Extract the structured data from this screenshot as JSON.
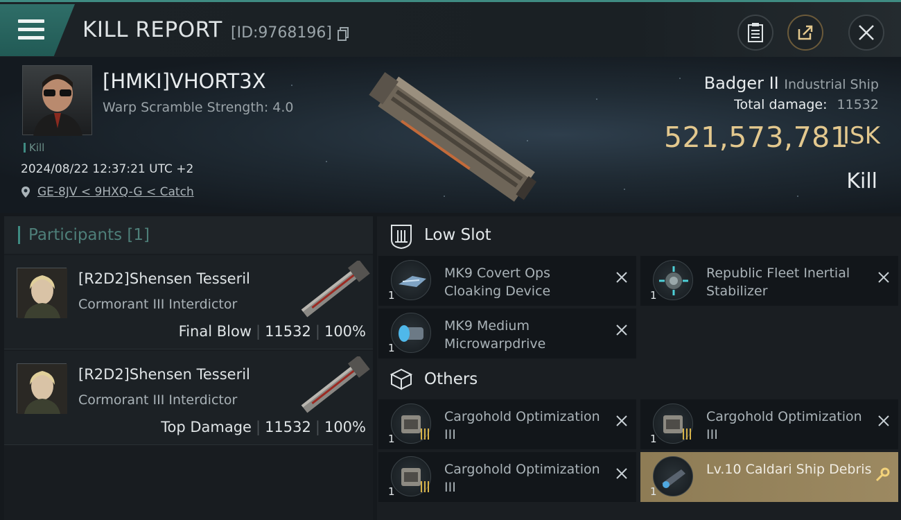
{
  "header": {
    "title": "KILL REPORT",
    "report_id": "[ID:9768196]"
  },
  "victim": {
    "pilot_name": "[HMKI]VHORT3X",
    "warp_scramble": "Warp Scramble Strength: 4.0",
    "tag": "Kill",
    "datetime": "2024/08/22 12:37:21 UTC +2",
    "location": "GE-8JV < 9HXQ-G < Catch",
    "ship_name": "Badger II",
    "ship_class": "Industrial Ship",
    "total_damage_label": "Total damage:",
    "total_damage": "11532",
    "isk_value": "521,573,781",
    "isk_unit": "ISK",
    "result": "Kill"
  },
  "participants": {
    "title": "Participants [1]",
    "cards": [
      {
        "name": "[R2D2]Shensen Tesseril",
        "ship": "Cormorant III Interdictor",
        "role": "Final Blow",
        "damage": "11532",
        "percent": "100%"
      },
      {
        "name": "[R2D2]Shensen Tesseril",
        "ship": "Cormorant III Interdictor",
        "role": "Top Damage",
        "damage": "11532",
        "percent": "100%"
      }
    ]
  },
  "sections": {
    "low_slot": "Low Slot",
    "others": "Others"
  },
  "items": [
    {
      "name": "MK9 Covert Ops Cloaking Device",
      "qty": "1"
    },
    {
      "name": "Republic Fleet Inertial Stabilizer",
      "qty": "1"
    },
    {
      "name": "MK9 Medium Microwarpdrive",
      "qty": "1"
    },
    {
      "name": "Cargohold Optimization III",
      "qty": "1"
    },
    {
      "name": "Cargohold Optimization III",
      "qty": "1"
    },
    {
      "name": "Cargohold Optimization III",
      "qty": "1"
    },
    {
      "name": "Lv.10 Caldari Ship Debris",
      "qty": "1"
    }
  ],
  "colors": {
    "accent": "#3f8b82",
    "isk": "#e3c88e",
    "highlight": "#9c8961"
  }
}
